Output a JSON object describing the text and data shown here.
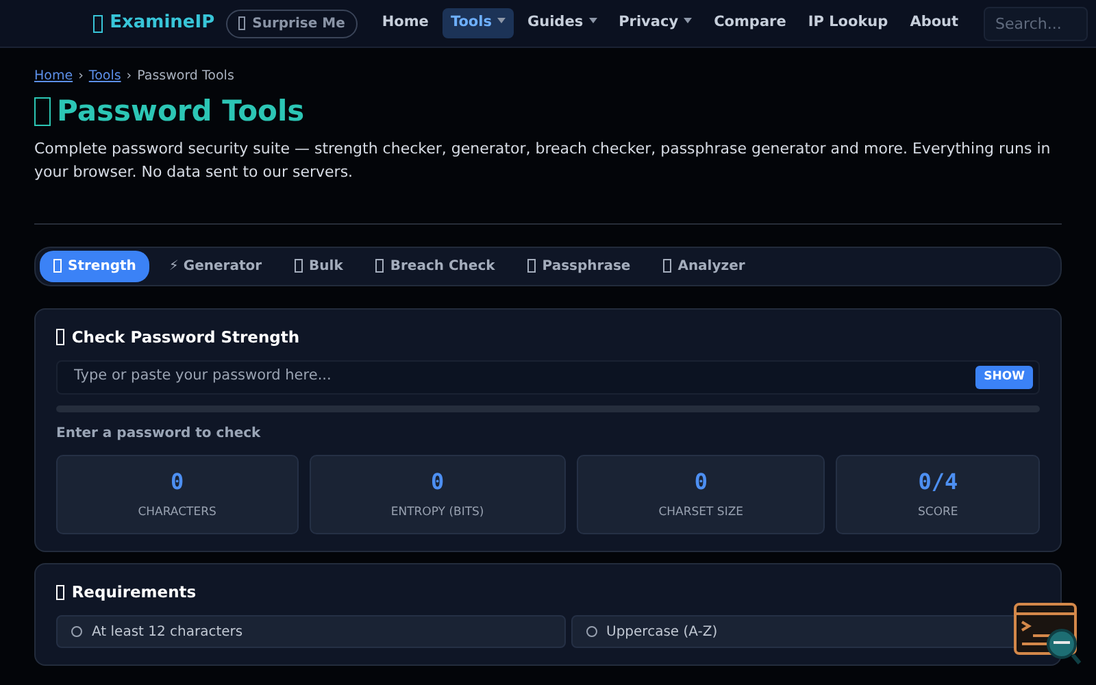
{
  "navbar": {
    "brand": "ExamineIP",
    "surprise_button": "Surprise Me",
    "links": [
      {
        "label": "Home",
        "selected": false,
        "dropdown": false
      },
      {
        "label": "Tools",
        "selected": true,
        "dropdown": true
      },
      {
        "label": "Guides",
        "selected": false,
        "dropdown": true
      },
      {
        "label": "Privacy",
        "selected": false,
        "dropdown": true
      },
      {
        "label": "Compare",
        "selected": false,
        "dropdown": false
      },
      {
        "label": "IP Lookup",
        "selected": false,
        "dropdown": false
      },
      {
        "label": "About",
        "selected": false,
        "dropdown": false
      }
    ],
    "search": {
      "placeholder": "Search..."
    }
  },
  "breadcrumb": [
    {
      "kind": "link",
      "label": "Home"
    },
    {
      "kind": "separator",
      "label": "›"
    },
    {
      "kind": "link",
      "label": "Tools"
    },
    {
      "kind": "separator",
      "label": "›"
    },
    {
      "kind": "current",
      "label": "Password Tools"
    }
  ],
  "title": "Password Tools",
  "description": "Complete password security suite — strength checker, generator, breach checker, passphrase generator and more. Everything runs in your browser. No data sent to our servers.",
  "tabs": [
    {
      "label": "Strength",
      "kind": "glyph",
      "selected": true
    },
    {
      "label": "⚡ Generator",
      "kind": "plain",
      "selected": false
    },
    {
      "label": "Bulk",
      "kind": "glyph",
      "selected": false
    },
    {
      "label": "Breach Check",
      "kind": "glyph",
      "selected": false
    },
    {
      "label": "Passphrase",
      "kind": "glyph",
      "selected": false
    },
    {
      "label": "Analyzer",
      "kind": "glyph",
      "selected": false
    }
  ],
  "strength_card": {
    "title": "Check Password Strength",
    "input": {
      "placeholder": "Type or paste your password here...",
      "toggle": "SHOW"
    },
    "meter": {
      "level": 0
    },
    "status": "Enter a password to check",
    "stats": [
      {
        "value": "0",
        "label": "CHARACTERS"
      },
      {
        "value": "0",
        "label": "ENTROPY (BITS)"
      },
      {
        "value": "0",
        "label": "CHARSET SIZE"
      },
      {
        "value": "0/4",
        "label": "SCORE"
      }
    ]
  },
  "requirements_card": {
    "title": "Requirements",
    "items": [
      {
        "label": "At least 12 characters",
        "met": false
      },
      {
        "label": "Uppercase (A-Z)",
        "met": false
      }
    ]
  }
}
